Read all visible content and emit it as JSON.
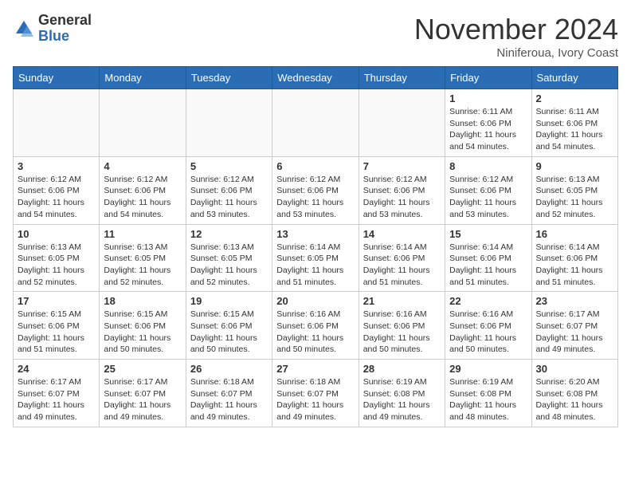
{
  "header": {
    "logo_line1": "General",
    "logo_line2": "Blue",
    "month": "November 2024",
    "location": "Niniferoua, Ivory Coast"
  },
  "weekdays": [
    "Sunday",
    "Monday",
    "Tuesday",
    "Wednesday",
    "Thursday",
    "Friday",
    "Saturday"
  ],
  "weeks": [
    [
      {
        "day": "",
        "info": ""
      },
      {
        "day": "",
        "info": ""
      },
      {
        "day": "",
        "info": ""
      },
      {
        "day": "",
        "info": ""
      },
      {
        "day": "",
        "info": ""
      },
      {
        "day": "1",
        "info": "Sunrise: 6:11 AM\nSunset: 6:06 PM\nDaylight: 11 hours\nand 54 minutes."
      },
      {
        "day": "2",
        "info": "Sunrise: 6:11 AM\nSunset: 6:06 PM\nDaylight: 11 hours\nand 54 minutes."
      }
    ],
    [
      {
        "day": "3",
        "info": "Sunrise: 6:12 AM\nSunset: 6:06 PM\nDaylight: 11 hours\nand 54 minutes."
      },
      {
        "day": "4",
        "info": "Sunrise: 6:12 AM\nSunset: 6:06 PM\nDaylight: 11 hours\nand 54 minutes."
      },
      {
        "day": "5",
        "info": "Sunrise: 6:12 AM\nSunset: 6:06 PM\nDaylight: 11 hours\nand 53 minutes."
      },
      {
        "day": "6",
        "info": "Sunrise: 6:12 AM\nSunset: 6:06 PM\nDaylight: 11 hours\nand 53 minutes."
      },
      {
        "day": "7",
        "info": "Sunrise: 6:12 AM\nSunset: 6:06 PM\nDaylight: 11 hours\nand 53 minutes."
      },
      {
        "day": "8",
        "info": "Sunrise: 6:12 AM\nSunset: 6:06 PM\nDaylight: 11 hours\nand 53 minutes."
      },
      {
        "day": "9",
        "info": "Sunrise: 6:13 AM\nSunset: 6:05 PM\nDaylight: 11 hours\nand 52 minutes."
      }
    ],
    [
      {
        "day": "10",
        "info": "Sunrise: 6:13 AM\nSunset: 6:05 PM\nDaylight: 11 hours\nand 52 minutes."
      },
      {
        "day": "11",
        "info": "Sunrise: 6:13 AM\nSunset: 6:05 PM\nDaylight: 11 hours\nand 52 minutes."
      },
      {
        "day": "12",
        "info": "Sunrise: 6:13 AM\nSunset: 6:05 PM\nDaylight: 11 hours\nand 52 minutes."
      },
      {
        "day": "13",
        "info": "Sunrise: 6:14 AM\nSunset: 6:05 PM\nDaylight: 11 hours\nand 51 minutes."
      },
      {
        "day": "14",
        "info": "Sunrise: 6:14 AM\nSunset: 6:06 PM\nDaylight: 11 hours\nand 51 minutes."
      },
      {
        "day": "15",
        "info": "Sunrise: 6:14 AM\nSunset: 6:06 PM\nDaylight: 11 hours\nand 51 minutes."
      },
      {
        "day": "16",
        "info": "Sunrise: 6:14 AM\nSunset: 6:06 PM\nDaylight: 11 hours\nand 51 minutes."
      }
    ],
    [
      {
        "day": "17",
        "info": "Sunrise: 6:15 AM\nSunset: 6:06 PM\nDaylight: 11 hours\nand 51 minutes."
      },
      {
        "day": "18",
        "info": "Sunrise: 6:15 AM\nSunset: 6:06 PM\nDaylight: 11 hours\nand 50 minutes."
      },
      {
        "day": "19",
        "info": "Sunrise: 6:15 AM\nSunset: 6:06 PM\nDaylight: 11 hours\nand 50 minutes."
      },
      {
        "day": "20",
        "info": "Sunrise: 6:16 AM\nSunset: 6:06 PM\nDaylight: 11 hours\nand 50 minutes."
      },
      {
        "day": "21",
        "info": "Sunrise: 6:16 AM\nSunset: 6:06 PM\nDaylight: 11 hours\nand 50 minutes."
      },
      {
        "day": "22",
        "info": "Sunrise: 6:16 AM\nSunset: 6:06 PM\nDaylight: 11 hours\nand 50 minutes."
      },
      {
        "day": "23",
        "info": "Sunrise: 6:17 AM\nSunset: 6:07 PM\nDaylight: 11 hours\nand 49 minutes."
      }
    ],
    [
      {
        "day": "24",
        "info": "Sunrise: 6:17 AM\nSunset: 6:07 PM\nDaylight: 11 hours\nand 49 minutes."
      },
      {
        "day": "25",
        "info": "Sunrise: 6:17 AM\nSunset: 6:07 PM\nDaylight: 11 hours\nand 49 minutes."
      },
      {
        "day": "26",
        "info": "Sunrise: 6:18 AM\nSunset: 6:07 PM\nDaylight: 11 hours\nand 49 minutes."
      },
      {
        "day": "27",
        "info": "Sunrise: 6:18 AM\nSunset: 6:07 PM\nDaylight: 11 hours\nand 49 minutes."
      },
      {
        "day": "28",
        "info": "Sunrise: 6:19 AM\nSunset: 6:08 PM\nDaylight: 11 hours\nand 49 minutes."
      },
      {
        "day": "29",
        "info": "Sunrise: 6:19 AM\nSunset: 6:08 PM\nDaylight: 11 hours\nand 48 minutes."
      },
      {
        "day": "30",
        "info": "Sunrise: 6:20 AM\nSunset: 6:08 PM\nDaylight: 11 hours\nand 48 minutes."
      }
    ]
  ]
}
